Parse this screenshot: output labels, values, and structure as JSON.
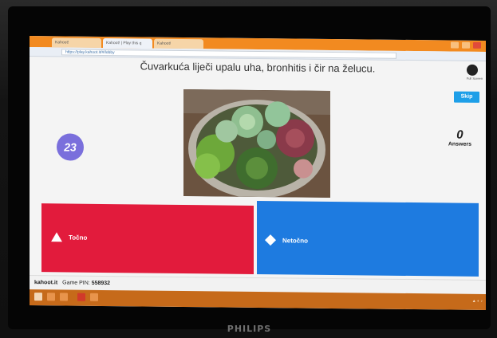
{
  "browser": {
    "tabs": [
      {
        "label": "Kahoot!"
      },
      {
        "label": "Kahoot! | Play this q"
      },
      {
        "label": "Kahoot!"
      }
    ],
    "url": "https://play.kahoot.it/#/lobby"
  },
  "game": {
    "question": "Čuvarkuća liječi upalu uha, bronhitis i čir na želucu.",
    "timer": "23",
    "answers_count": "0",
    "answers_label": "Answers",
    "skip_label": "Skip",
    "fullscreen_label": "Full Screen"
  },
  "answers": [
    {
      "label": "Točno",
      "color": "#e21b3c",
      "shape": "triangle-icon"
    },
    {
      "label": "Netočno",
      "color": "#1e7be0",
      "shape": "diamond-icon"
    }
  ],
  "footer": {
    "site": "kahoot.it",
    "pin_label": "Game PIN:",
    "pin": "558932"
  },
  "monitor": {
    "brand": "PHILIPS"
  },
  "colors": {
    "titlebar": "#f28a20",
    "timer": "#7a6fdc",
    "skip": "#1e9fe8",
    "taskbar": "#c66a1a"
  }
}
